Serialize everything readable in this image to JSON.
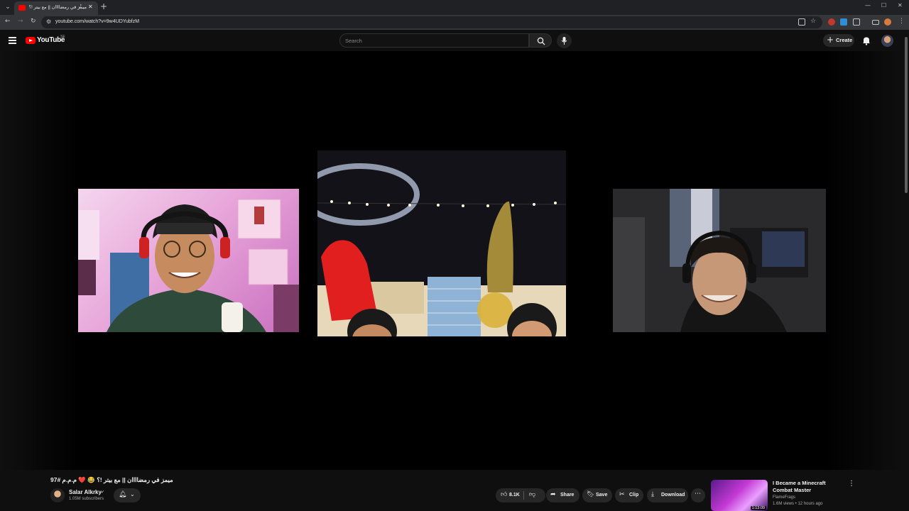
{
  "browser": {
    "tab_title": "ميمز في رمضاااان || مع بيتر !؟ 😂 ❤️ م.م.م #97",
    "url": "youtube.com/watch?v=9w4UDYubfzM"
  },
  "header": {
    "logo_text": "YouTube",
    "country_code": "SE",
    "search_placeholder": "Search",
    "create_label": "Create"
  },
  "video": {
    "title": "ميمز في رمضاااان || مع بيتر !؟ 😂 ❤️ م.م.م #97",
    "channel_name": "Salar Alkrky",
    "subscribers": "1.05M subscribers",
    "likes": "8.1K",
    "share_label": "Share",
    "save_label": "Save",
    "clip_label": "Clip",
    "download_label": "Download"
  },
  "recommended": {
    "title": "I Became a Minecraft Combat Master",
    "channel": "FlameFrags",
    "meta": "1.6M views • 12 hours ago",
    "duration": "1:13:09"
  },
  "icons": {
    "accent": "#ff0000"
  }
}
